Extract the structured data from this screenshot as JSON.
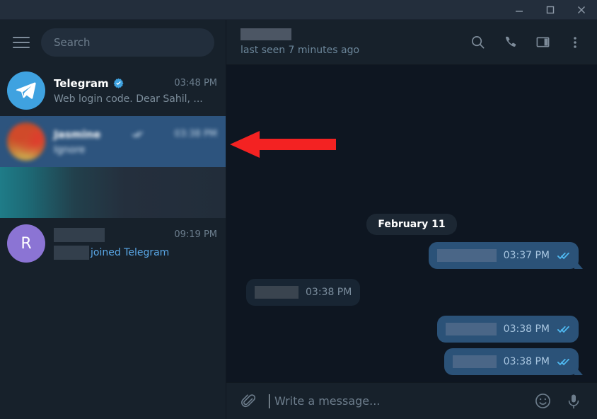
{
  "window": {
    "minimize_label": "Minimize",
    "maximize_label": "Maximize",
    "close_label": "Close"
  },
  "sidebar": {
    "menu_label": "Menu",
    "search_placeholder": "Search",
    "chats": [
      {
        "name": "Telegram",
        "verified": true,
        "time": "03:48 PM",
        "preview": "Web login code. Dear Sahil, ...",
        "avatar_type": "telegram",
        "avatar_letter": "",
        "selected": false,
        "redacted": false
      },
      {
        "name": "Jasmine",
        "verified": false,
        "time": "03:38 PM",
        "preview": "Ignore",
        "avatar_type": "blurphoto",
        "avatar_letter": "",
        "selected": true,
        "redacted": true
      },
      {
        "name": "",
        "verified": false,
        "time": "",
        "preview": "",
        "avatar_type": "gradient",
        "avatar_letter": "",
        "selected": false,
        "redacted": true
      },
      {
        "name": "",
        "verified": false,
        "time": "09:19 PM",
        "preview": "joined Telegram",
        "avatar_type": "letter",
        "avatar_letter": "R",
        "selected": false,
        "redacted": true
      }
    ]
  },
  "chat_header": {
    "peer_name": "",
    "status": "last seen 7 minutes ago",
    "search_label": "Search messages",
    "call_label": "Call",
    "panel_label": "Toggle info panel",
    "more_label": "More options"
  },
  "conversation": {
    "date_divider": "February 11",
    "messages": [
      {
        "direction": "out",
        "text": "",
        "time": "03:37 PM",
        "status": "read",
        "tail": true
      },
      {
        "direction": "in",
        "text": "",
        "time": "03:38 PM",
        "status": "none",
        "tail": false
      },
      {
        "direction": "out",
        "text": "",
        "time": "03:38 PM",
        "status": "read",
        "tail": false
      },
      {
        "direction": "out",
        "text": "",
        "time": "03:38 PM",
        "status": "read",
        "tail": true
      }
    ]
  },
  "composer": {
    "attach_label": "Attach file",
    "placeholder": "Write a message...",
    "emoji_label": "Emoji",
    "voice_label": "Record voice message"
  },
  "annotation": {
    "arrow_label": "red-pointer-arrow",
    "color": "#f32222"
  },
  "colors": {
    "titlebar": "#232e3c",
    "sidebar": "#17212b",
    "selected_row": "#2d547e",
    "chat_background": "#0e1621",
    "bubble_out": "#2b5278",
    "bubble_in": "#182533",
    "accent": "#3fa2e0",
    "tick_blue": "#4fb8f0"
  }
}
